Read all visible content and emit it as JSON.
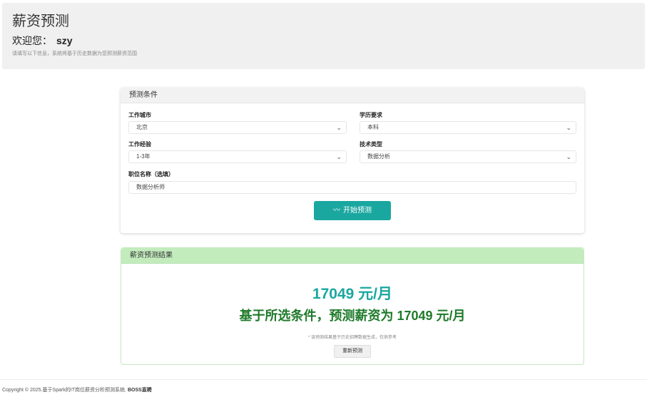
{
  "header": {
    "title": "薪资预测",
    "welcome_label": "欢迎您：",
    "username": "szy",
    "hint": "请填写以下信息，系统将基于历史数据为您预测薪资范围"
  },
  "conditions": {
    "title": "预测条件",
    "city_label": "工作城市",
    "city_value": "北京",
    "education_label": "学历要求",
    "education_value": "本科",
    "experience_label": "工作经验",
    "experience_value": "1-3年",
    "tech_label": "技术类型",
    "tech_value": "数据分析",
    "position_label": "职位名称（选填）",
    "position_value": "数据分析师",
    "submit_label": "开始预测",
    "submit_icon": "chart-line-icon"
  },
  "result": {
    "title": "薪资预测结果",
    "amount": "17049 元/月",
    "statement": "基于所选条件，预测薪资为 17049 元/月",
    "note": "* 该预测结果基于历史招聘数据生成，仅供参考",
    "retry_label": "重新预测"
  },
  "footer": {
    "text": "Copyright © 2025.基于Spark的IT岗位薪资分析预测系统.",
    "brand": "BOSS直聘"
  },
  "colors": {
    "accent": "#1aa7a0",
    "result_header": "#c3ecbd",
    "result_text": "#1e7a2a"
  }
}
